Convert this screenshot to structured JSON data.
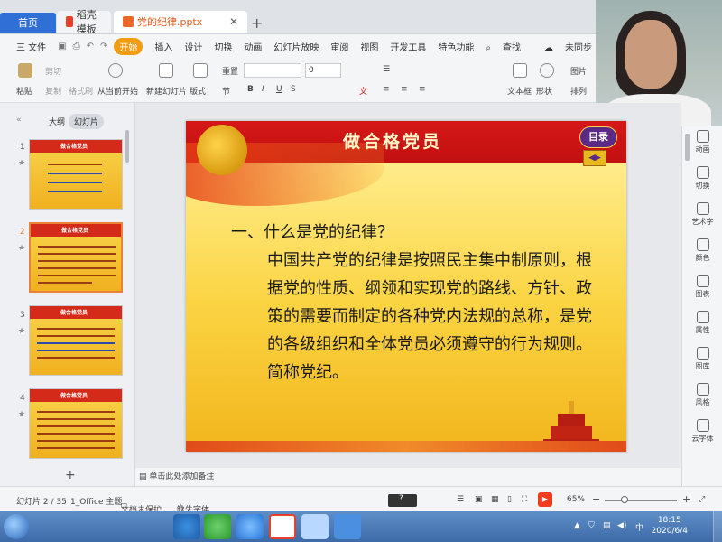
{
  "tabs": {
    "home": "首页",
    "template": "稻壳模板",
    "document": "党的纪律.pptx",
    "close": "✕",
    "add": "+"
  },
  "menu": {
    "file": "三 文件",
    "items": [
      "开始",
      "插入",
      "设计",
      "切换",
      "动画",
      "幻灯片放映",
      "审阅",
      "视图",
      "开发工具",
      "特色功能"
    ],
    "active_index": 0,
    "search": "查找",
    "sync": "未同步"
  },
  "ribbon": {
    "paste": "粘贴",
    "cut": "剪切",
    "copy": "复制",
    "format_painter": "格式刷",
    "from_current": "从当前开始",
    "new_slide": "新建幻灯片",
    "layout": "版式",
    "section": "节",
    "reset": "重置",
    "font_size": "0",
    "textbox": "文本框",
    "shape": "形状",
    "picture": "图片",
    "arrange": "排列"
  },
  "left_panel": {
    "outline_tab": "大纲",
    "slides_tab": "幻灯片",
    "thumbnails": [
      {
        "num": "1",
        "title": "做合格党员"
      },
      {
        "num": "2",
        "title": "做合格党员"
      },
      {
        "num": "3",
        "title": "做合格党员"
      },
      {
        "num": "4",
        "title": "做合格党员"
      }
    ],
    "add": "+"
  },
  "slide": {
    "title": "做合格党员",
    "toc_button": "目录",
    "arrows": "◀▶",
    "question": "一、什么是党的纪律？",
    "answer": "中国共产党的纪律是按照民主集中制原则，根据党的性质、纲领和实现党的路线、方针、政策的需要而制定的各种党内法规的总称，是党的各级组织和全体党员必须遵守的行为规则。简称党纪。"
  },
  "right_panel": {
    "items": [
      "动画",
      "切换",
      "艺术字",
      "颜色",
      "图表",
      "属性",
      "图库",
      "风格",
      "云字体"
    ]
  },
  "notes": {
    "placeholder": "单击此处添加备注"
  },
  "status": {
    "slide_count": "幻灯片 2 / 35",
    "theme": "1_Office 主题",
    "protect": "文档未保护",
    "missing_font": "缺失字体",
    "zoom": "65%",
    "minus": "−",
    "plus": "+"
  },
  "taskbar": {
    "time": "18:15",
    "date": "2020/6/4"
  },
  "colors": {
    "accent_orange": "#f39c12",
    "banner_red": "#d51818",
    "slide_yellow": "#fbd443",
    "toc_purple": "#5b2a86",
    "home_blue": "#2f6fd6"
  }
}
